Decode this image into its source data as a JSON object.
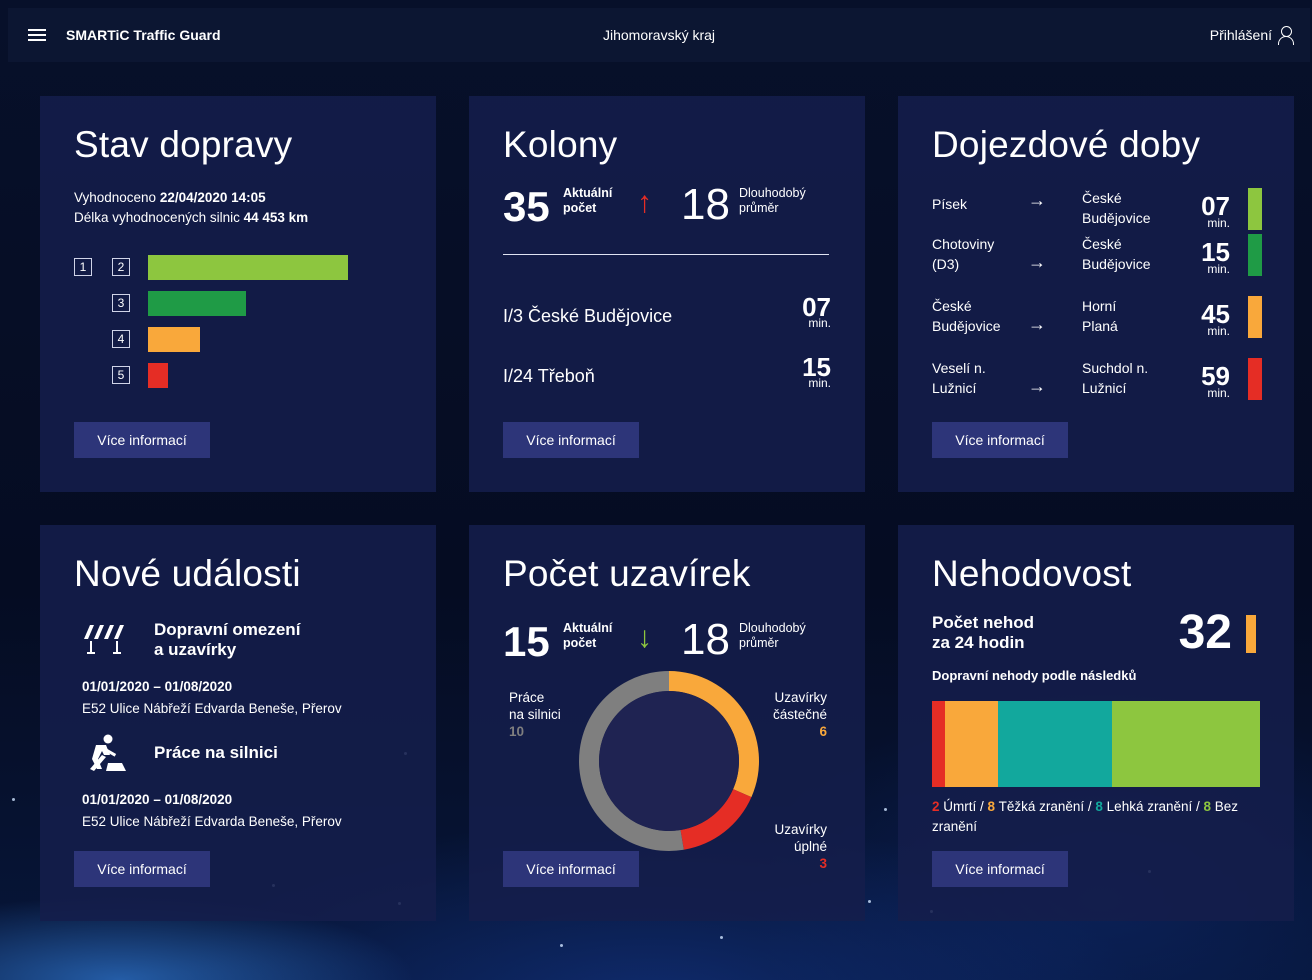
{
  "header": {
    "brand": "SMARTiC Traffic Guard",
    "region": "Jihomoravský kraj",
    "login_label": "Přihlášení"
  },
  "common": {
    "more_label": "Více informací"
  },
  "traffic_state": {
    "title": "Stav dopravy",
    "evaluated_label": "Vyhodnoceno",
    "evaluated_value": "22/04/2020 14:05",
    "length_label": "Délka vyhodnocených silnic",
    "length_value": "44 453 km",
    "levels": [
      {
        "label": "1",
        "value": 0
      },
      {
        "label": "2",
        "value": 1.0,
        "color": "#8dc63f"
      },
      {
        "label": "3",
        "value": 0.49,
        "color": "#1f9b46"
      },
      {
        "label": "4",
        "value": 0.26,
        "color": "#f9a83b"
      },
      {
        "label": "5",
        "value": 0.1,
        "color": "#e52d25"
      }
    ]
  },
  "queues": {
    "title": "Kolony",
    "current_value": "35",
    "current_label_1": "Aktuální",
    "current_label_2": "počet",
    "trend_color": "#e52d25",
    "avg_value": "18",
    "avg_label_1": "Dlouhodobý",
    "avg_label_2": "průměr",
    "routes": [
      {
        "name": "I/3 České Budějovice",
        "time": "07",
        "unit": "min."
      },
      {
        "name": "I/24 Třeboň",
        "time": "15",
        "unit": "min."
      }
    ]
  },
  "travel_times": {
    "title": "Dojezdové doby",
    "rows": [
      {
        "from": [
          "Písek"
        ],
        "to": [
          "České",
          "Budějovice"
        ],
        "time": "07",
        "unit": "min.",
        "color": "#8dc63f"
      },
      {
        "from": [
          "Chotoviny",
          "(D3)"
        ],
        "to": [
          "České",
          "Budějovice"
        ],
        "time": "15",
        "unit": "min.",
        "color": "#1f9b46"
      },
      {
        "from": [
          "České",
          "Budějovice"
        ],
        "to": [
          "Horní",
          "Planá"
        ],
        "time": "45",
        "unit": "min.",
        "color": "#f9a83b"
      },
      {
        "from": [
          "Veselí n.",
          "Lužnicí"
        ],
        "to": [
          "Suchdol n.",
          "Lužnicí"
        ],
        "time": "59",
        "unit": "min.",
        "color": "#e52d25"
      }
    ]
  },
  "events": {
    "title": "Nové události",
    "items": [
      {
        "icon": "roadblock-icon",
        "title_1": "Dopravní omezení",
        "title_2": "a uzavírky",
        "date": "01/01/2020 – 01/08/2020",
        "place": "E52 Ulice Nábřeží Edvarda Beneše, Přerov"
      },
      {
        "icon": "roadwork-icon",
        "title_1": "Práce na silnici",
        "title_2": "",
        "date": "01/01/2020 – 01/08/2020",
        "place": "E52 Ulice Nábřeží Edvarda Beneše, Přerov"
      }
    ]
  },
  "closures": {
    "title": "Počet uzavírek",
    "current_value": "15",
    "current_label_1": "Aktuální",
    "current_label_2": "počet",
    "trend_color": "#8dc63f",
    "avg_value": "18",
    "avg_label_1": "Dlouhodobý",
    "avg_label_2": "průměr",
    "segments": [
      {
        "label_1": "Uzavírky",
        "label_2": "částečné",
        "value": 6,
        "color": "#f9a83b"
      },
      {
        "label_1": "Uzavírky",
        "label_2": "úplné",
        "value": 3,
        "color": "#e52d25"
      },
      {
        "label_1": "Práce",
        "label_2": "na silnici",
        "value": 10,
        "color": "#7f7f7f"
      }
    ]
  },
  "accidents": {
    "title": "Nehodovost",
    "count_label_1": "Počet nehod",
    "count_label_2": "za 24 hodin",
    "count_value": "32",
    "flag_color": "#f9a83b",
    "subtitle": "Dopravní nehody podle následků",
    "breakdown": [
      {
        "value": 2,
        "label": "Úmrtí",
        "color": "#e52d25"
      },
      {
        "value": 8,
        "label": "Těžká zranění",
        "color": "#f9a83b"
      },
      {
        "value": 8,
        "label": "Lehká zranění",
        "color": "#12a89d"
      },
      {
        "value": 8,
        "label": "Bez zranění",
        "color": "#8dc63f"
      }
    ],
    "bar_widths": [
      0.04,
      0.16,
      0.35,
      0.45
    ]
  }
}
